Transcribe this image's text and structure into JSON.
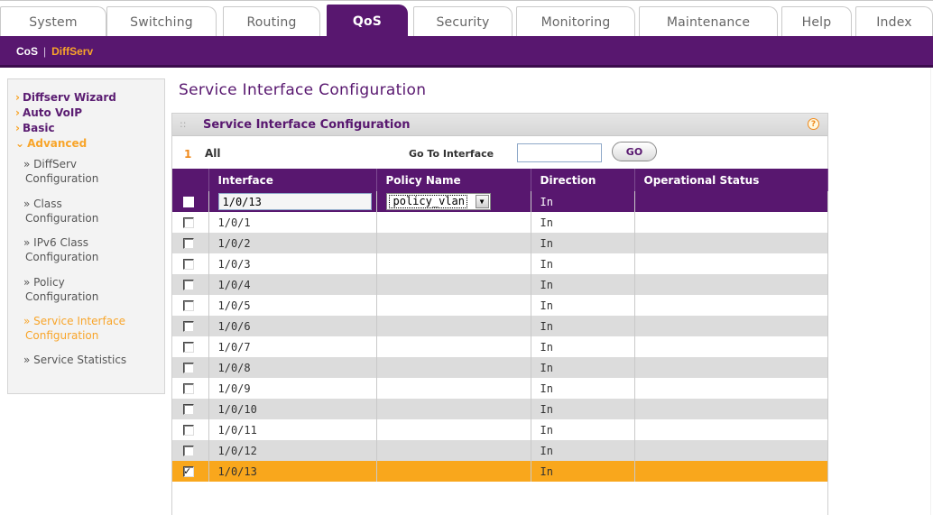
{
  "top_tabs": [
    {
      "label": "System",
      "active": false
    },
    {
      "label": "Switching",
      "active": false
    },
    {
      "label": "Routing",
      "active": false
    },
    {
      "label": "QoS",
      "active": true
    },
    {
      "label": "Security",
      "active": false
    },
    {
      "label": "Monitoring",
      "active": false
    },
    {
      "label": "Maintenance",
      "active": false
    },
    {
      "label": "Help",
      "active": false
    },
    {
      "label": "Index",
      "active": false
    }
  ],
  "subnav": {
    "items": [
      "CoS",
      "DiffServ"
    ],
    "separator": "|",
    "selected": "DiffServ"
  },
  "leftnav": {
    "main": [
      {
        "label": "Diffserv Wizard",
        "arrow": "›"
      },
      {
        "label": "Auto VoIP",
        "arrow": "›"
      },
      {
        "label": "Basic",
        "arrow": "›"
      },
      {
        "label": "Advanced",
        "arrow": "⌄"
      }
    ],
    "sub": [
      {
        "line1": "» DiffServ",
        "line2": "Configuration"
      },
      {
        "line1": "» Class",
        "line2": "Configuration"
      },
      {
        "line1": "» IPv6 Class",
        "line2": "Configuration"
      },
      {
        "line1": "» Policy",
        "line2": "Configuration"
      },
      {
        "line1": "» Service Interface",
        "line2": "Configuration"
      },
      {
        "line1": "» Service Statistics",
        "line2": ""
      }
    ]
  },
  "page": {
    "title": "Service Interface Configuration"
  },
  "panel": {
    "title": "Service Interface Configuration",
    "grip": "::",
    "help_icon": "?",
    "page_number": "1",
    "all_label": "All",
    "goto_label": "Go To Interface",
    "goto_value": "",
    "go_button": "GO"
  },
  "table": {
    "headers": [
      "Interface",
      "Policy Name",
      "Direction",
      "Operational Status"
    ],
    "edit_row": {
      "interface": "1/0/13",
      "policy": "policy_vlan",
      "direction": "In",
      "status": ""
    },
    "rows": [
      {
        "interface": "1/0/1",
        "policy": "",
        "direction": "In",
        "status": "",
        "checked": false
      },
      {
        "interface": "1/0/2",
        "policy": "",
        "direction": "In",
        "status": "",
        "checked": false
      },
      {
        "interface": "1/0/3",
        "policy": "",
        "direction": "In",
        "status": "",
        "checked": false
      },
      {
        "interface": "1/0/4",
        "policy": "",
        "direction": "In",
        "status": "",
        "checked": false
      },
      {
        "interface": "1/0/5",
        "policy": "",
        "direction": "In",
        "status": "",
        "checked": false
      },
      {
        "interface": "1/0/6",
        "policy": "",
        "direction": "In",
        "status": "",
        "checked": false
      },
      {
        "interface": "1/0/7",
        "policy": "",
        "direction": "In",
        "status": "",
        "checked": false
      },
      {
        "interface": "1/0/8",
        "policy": "",
        "direction": "In",
        "status": "",
        "checked": false
      },
      {
        "interface": "1/0/9",
        "policy": "",
        "direction": "In",
        "status": "",
        "checked": false
      },
      {
        "interface": "1/0/10",
        "policy": "",
        "direction": "In",
        "status": "",
        "checked": false
      },
      {
        "interface": "1/0/11",
        "policy": "",
        "direction": "In",
        "status": "",
        "checked": false
      },
      {
        "interface": "1/0/12",
        "policy": "",
        "direction": "In",
        "status": "",
        "checked": false
      },
      {
        "interface": "1/0/13",
        "policy": "",
        "direction": "In",
        "status": "",
        "checked": true
      }
    ]
  },
  "colors": {
    "brand_purple": "#58176f",
    "accent_orange": "#f9a71c",
    "row_gray": "#dcdcdc"
  }
}
